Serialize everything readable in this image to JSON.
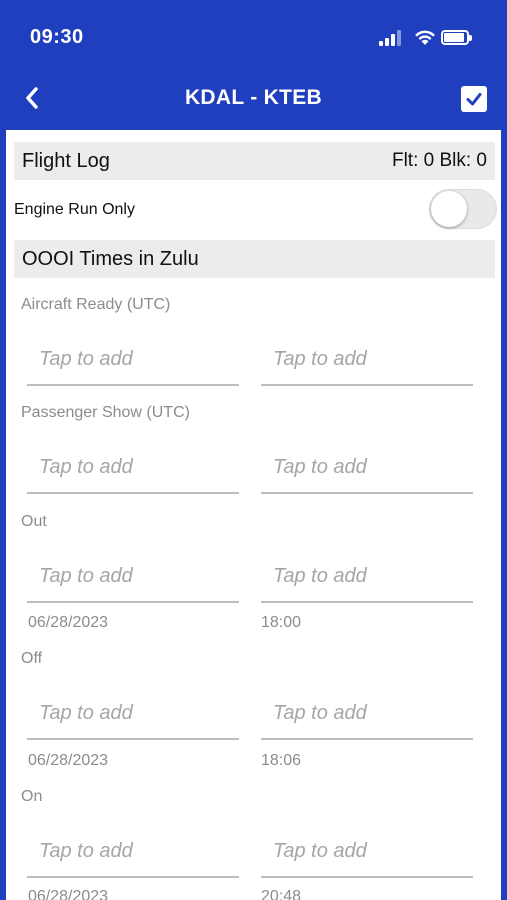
{
  "status_bar": {
    "time": "09:30"
  },
  "nav": {
    "title": "KDAL - KTEB"
  },
  "flight_log": {
    "title": "Flight Log",
    "summary": "Flt: 0 Blk: 0"
  },
  "engine_run_only": {
    "label": "Engine Run Only",
    "enabled": false
  },
  "oooi": {
    "title": "OOOI Times in Zulu"
  },
  "fields": [
    {
      "label": "Aircraft Ready (UTC)",
      "date_placeholder": "Tap to add",
      "time_placeholder": "Tap to add",
      "date_hint": "",
      "time_hint": ""
    },
    {
      "label": "Passenger Show (UTC)",
      "date_placeholder": "Tap to add",
      "time_placeholder": "Tap to add",
      "date_hint": "",
      "time_hint": ""
    },
    {
      "label": "Out",
      "date_placeholder": "Tap to add",
      "time_placeholder": "Tap to add",
      "date_hint": "06/28/2023",
      "time_hint": "18:00"
    },
    {
      "label": "Off",
      "date_placeholder": "Tap to add",
      "time_placeholder": "Tap to add",
      "date_hint": "06/28/2023",
      "time_hint": "18:06"
    },
    {
      "label": "On",
      "date_placeholder": "Tap to add",
      "time_placeholder": "Tap to add",
      "date_hint": "06/28/2023",
      "time_hint": "20:48"
    }
  ],
  "colors": {
    "header": "#1f3fbf",
    "section_bg": "#ececec",
    "placeholder": "#a6a6a6",
    "underline": "#bdbdbd"
  },
  "icons": {
    "back": "chevron-left-icon",
    "done": "checkbox-checked-icon"
  }
}
